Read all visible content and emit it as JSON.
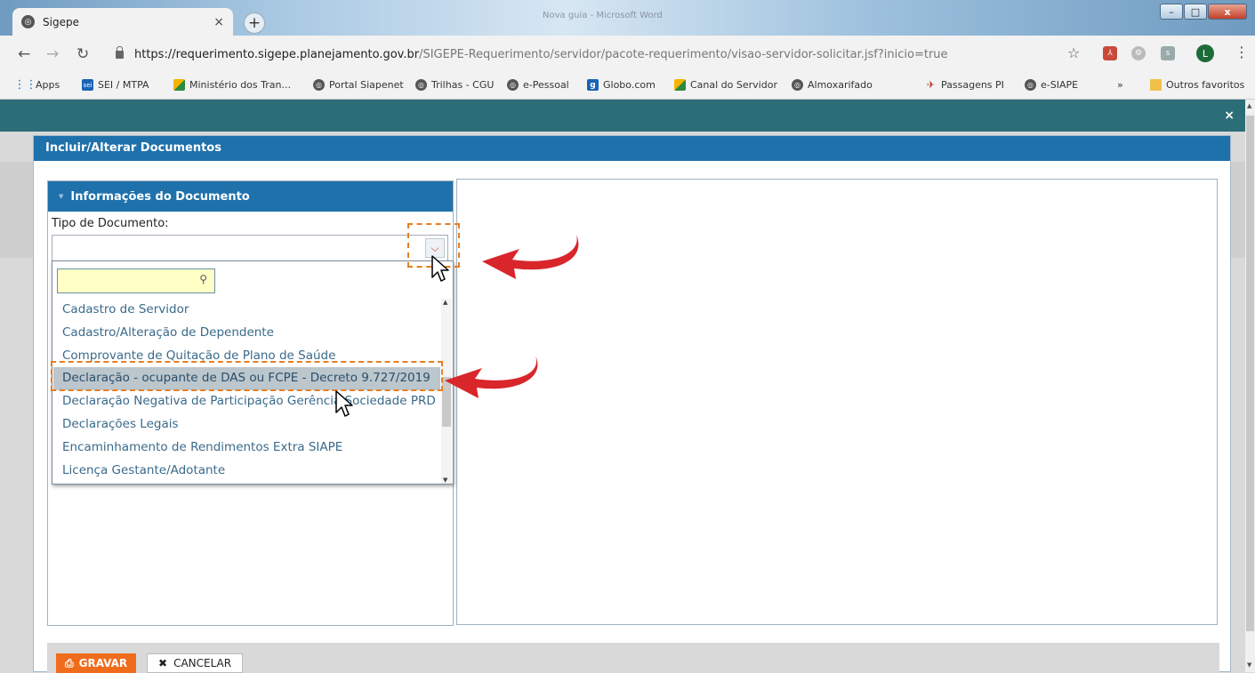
{
  "browser": {
    "tab_title": "Sigepe",
    "tab_close": "×",
    "new_tab": "+",
    "window_title": "Nova guia - Microsoft Word",
    "window_buttons": {
      "minimize": "–",
      "maximize": "□",
      "close": "x"
    },
    "url_host": "https://requerimento.sigepe.planejamento.gov.br",
    "url_path": "/SIGEPE-Requerimento/servidor/pacote-requerimento/visao-servidor-solicitar.jsf?inicio=true",
    "avatar_letter": "L",
    "bookmarks": [
      {
        "label": "Apps",
        "icon": "apps-grid-icon"
      },
      {
        "label": "SEI / MTPA",
        "icon": "sei-icon"
      },
      {
        "label": "Ministério dos Tran...",
        "icon": "play-icon"
      },
      {
        "label": "Portal Siapenet",
        "icon": "globe-icon"
      },
      {
        "label": "Trilhas - CGU",
        "icon": "globe-icon"
      },
      {
        "label": "e-Pessoal",
        "icon": "globe-icon"
      },
      {
        "label": "Globo.com",
        "icon": "g-icon"
      },
      {
        "label": "Canal do Servidor",
        "icon": "play-icon"
      },
      {
        "label": "Almoxarifado",
        "icon": "globe-icon"
      },
      {
        "label": "Passagens PI",
        "icon": "plane-icon"
      },
      {
        "label": "e-SIAPE",
        "icon": "globe-icon"
      }
    ],
    "bookmarks_more": "»",
    "other_bookmarks": "Outros favoritos"
  },
  "modal": {
    "close": "×",
    "dialog_title": "Incluir/Alterar Documentos",
    "section_title": "Informações do Documento",
    "field_label": "Tipo de Documento:",
    "field_value": "",
    "search_value": "",
    "options": [
      "Cadastro de Servidor",
      "Cadastro/Alteração de Dependente",
      "Comprovante de Quitação de Plano de Saúde",
      "Declaração - ocupante de DAS ou FCPE - Decreto 9.727/2019",
      "Declaração Negativa de Participação Gerência Sociedade PRD",
      "Declarações Legais",
      "Encaminhamento de Rendimentos Extra SIAPE",
      "Licença Gestante/Adotante"
    ],
    "highlighted_option": "Declaração - ocupante de DAS ou FCPE - Decreto 9.727/2019",
    "buttons": {
      "save": "GRAVAR",
      "cancel": "CANCELAR"
    }
  },
  "colors": {
    "dialog_header": "#1f71ab",
    "modal_header": "#2b6e78",
    "save_button": "#ef6c1c",
    "annotation_dash": "#e67e22",
    "annotation_arrow": "#d8262b",
    "highlight_row": "#bcc6cd",
    "search_bg": "#ffffc6"
  }
}
